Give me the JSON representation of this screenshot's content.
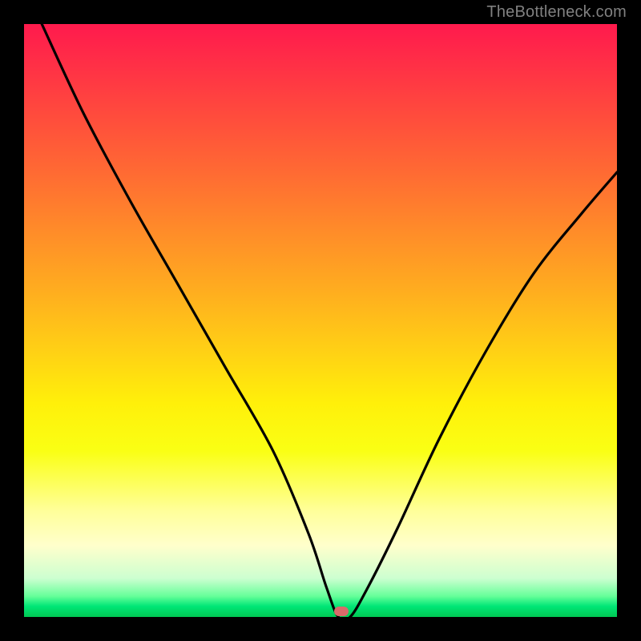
{
  "watermark": "TheBottleneck.com",
  "marker": {
    "x_pct": 53.5,
    "y_pct": 99.0,
    "color": "#d96a6a"
  },
  "chart_data": {
    "type": "line",
    "title": "",
    "xlabel": "",
    "ylabel": "",
    "xlim": [
      0,
      100
    ],
    "ylim": [
      0,
      100
    ],
    "grid": false,
    "legend": false,
    "series": [
      {
        "name": "bottleneck-curve",
        "x": [
          3,
          10,
          18,
          26,
          34,
          42,
          48,
          51,
          53,
          55,
          58,
          63,
          70,
          78,
          86,
          94,
          100
        ],
        "y": [
          100,
          85,
          70,
          56,
          42,
          28,
          14,
          5,
          0,
          0,
          5,
          15,
          30,
          45,
          58,
          68,
          75
        ]
      }
    ],
    "annotations": [
      {
        "type": "marker",
        "x": 53.5,
        "y": 0,
        "label": "optimal-point"
      }
    ],
    "background_gradient": {
      "orientation": "vertical",
      "stops": [
        {
          "pct": 0,
          "color": "#ff1a4d"
        },
        {
          "pct": 25,
          "color": "#ff6a33"
        },
        {
          "pct": 55,
          "color": "#ffd015"
        },
        {
          "pct": 82,
          "color": "#ffff99"
        },
        {
          "pct": 96,
          "color": "#66ff99"
        },
        {
          "pct": 100,
          "color": "#00c853"
        }
      ]
    }
  }
}
